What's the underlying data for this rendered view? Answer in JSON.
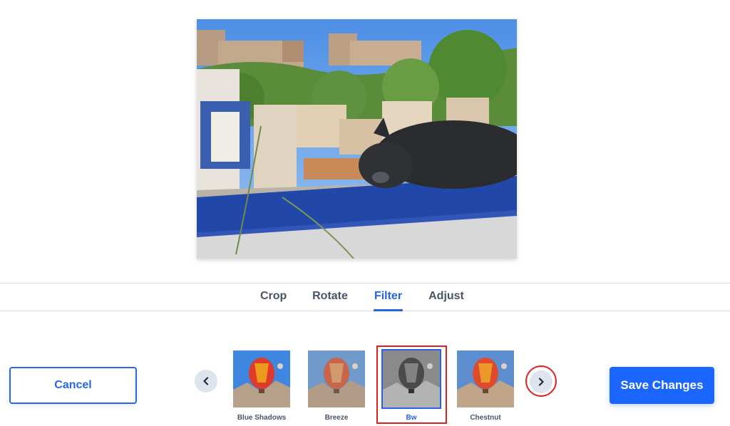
{
  "tabs": [
    {
      "label": "Crop",
      "active": false
    },
    {
      "label": "Rotate",
      "active": false
    },
    {
      "label": "Filter",
      "active": true
    },
    {
      "label": "Adjust",
      "active": false
    }
  ],
  "buttons": {
    "cancel": "Cancel",
    "save": "Save Changes"
  },
  "filters": [
    {
      "label": "Blue Shadows",
      "selected": false
    },
    {
      "label": "Breeze",
      "selected": false
    },
    {
      "label": "Bw",
      "selected": true
    },
    {
      "label": "Chestnut",
      "selected": false
    }
  ],
  "icons": {
    "prev": "chevron-left-icon",
    "next": "chevron-right-icon"
  },
  "colors": {
    "accent": "#2563eb",
    "save_bg": "#1a66ff",
    "highlight": "#e02020"
  }
}
